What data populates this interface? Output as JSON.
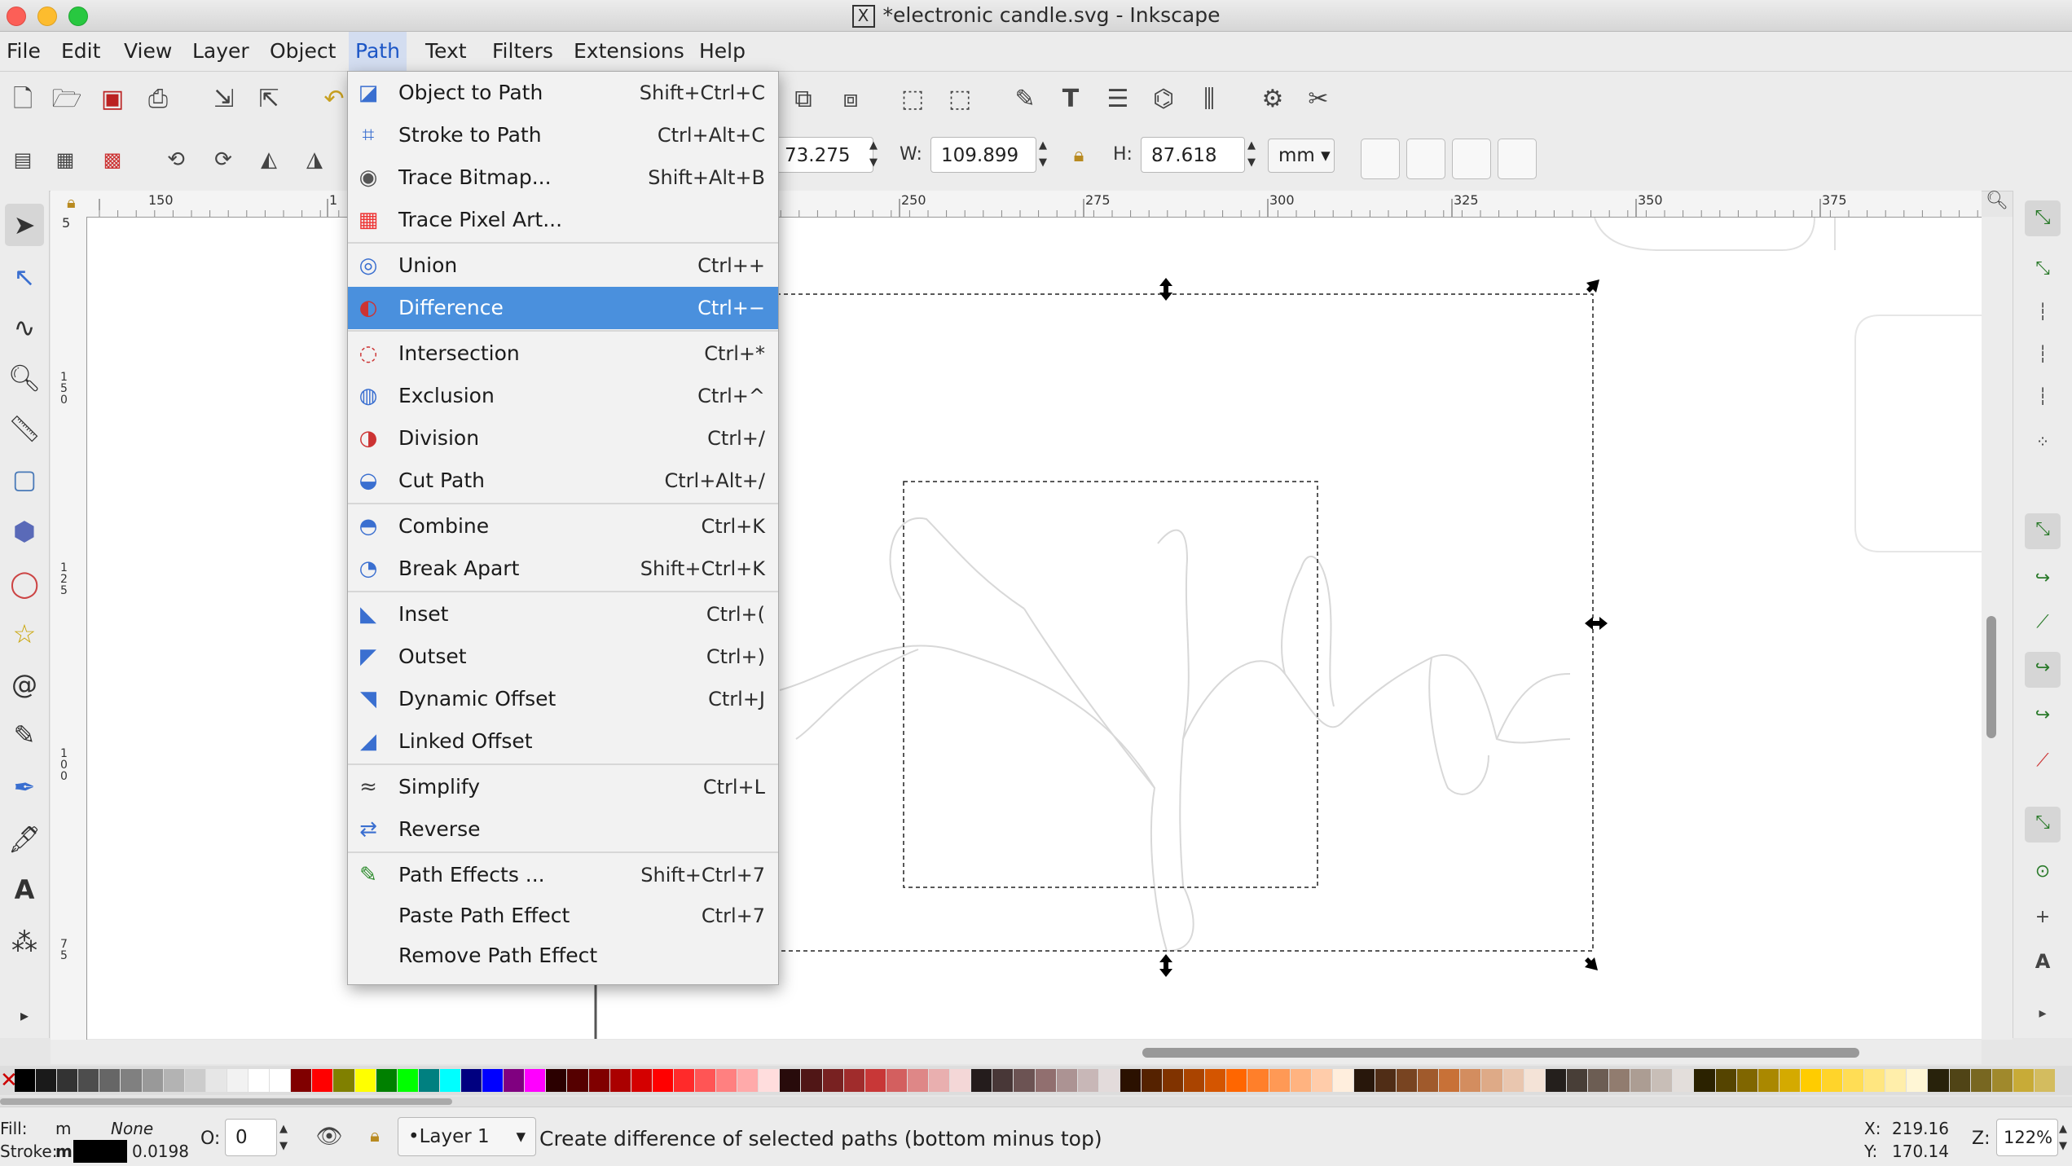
{
  "window": {
    "title": "*electronic candle.svg - Inkscape"
  },
  "menubar": [
    "File",
    "Edit",
    "View",
    "Layer",
    "Object",
    "Path",
    "Text",
    "Filters",
    "Extensions",
    "Help"
  ],
  "open_menu": "Path",
  "path_menu": {
    "items": [
      {
        "label": "Object to Path",
        "shortcut": "Shift+Ctrl+C",
        "icon": "object-to-path-icon"
      },
      {
        "label": "Stroke to Path",
        "shortcut": "Ctrl+Alt+C",
        "icon": "stroke-to-path-icon"
      },
      {
        "label": "Trace Bitmap...",
        "shortcut": "Shift+Alt+B",
        "icon": "trace-bitmap-icon"
      },
      {
        "label": "Trace Pixel Art...",
        "shortcut": "",
        "icon": "trace-pixel-art-icon"
      },
      {
        "label": "Union",
        "shortcut": "Ctrl++",
        "icon": "union-icon"
      },
      {
        "label": "Difference",
        "shortcut": "Ctrl+−",
        "icon": "difference-icon",
        "highlighted": true
      },
      {
        "label": "Intersection",
        "shortcut": "Ctrl+*",
        "icon": "intersection-icon"
      },
      {
        "label": "Exclusion",
        "shortcut": "Ctrl+^",
        "icon": "exclusion-icon"
      },
      {
        "label": "Division",
        "shortcut": "Ctrl+/",
        "icon": "division-icon"
      },
      {
        "label": "Cut Path",
        "shortcut": "Ctrl+Alt+/",
        "icon": "cut-path-icon"
      },
      {
        "label": "Combine",
        "shortcut": "Ctrl+K",
        "icon": "combine-icon"
      },
      {
        "label": "Break Apart",
        "shortcut": "Shift+Ctrl+K",
        "icon": "break-apart-icon"
      },
      {
        "label": "Inset",
        "shortcut": "Ctrl+(",
        "icon": "inset-icon"
      },
      {
        "label": "Outset",
        "shortcut": "Ctrl+)",
        "icon": "outset-icon"
      },
      {
        "label": "Dynamic Offset",
        "shortcut": "Ctrl+J",
        "icon": "dynamic-offset-icon"
      },
      {
        "label": "Linked Offset",
        "shortcut": "",
        "icon": "linked-offset-icon"
      },
      {
        "label": "Simplify",
        "shortcut": "Ctrl+L",
        "icon": "simplify-icon"
      },
      {
        "label": "Reverse",
        "shortcut": "",
        "icon": "reverse-icon"
      },
      {
        "label": "Path Effects ...",
        "shortcut": "Shift+Ctrl+7",
        "icon": "path-effects-icon"
      },
      {
        "label": "Paste Path Effect",
        "shortcut": "Ctrl+7",
        "icon": ""
      },
      {
        "label": "Remove Path Effect",
        "shortcut": "",
        "icon": ""
      }
    ]
  },
  "toolbar": {
    "x_value": "73.275",
    "w_label": "W:",
    "w_value": "109.899",
    "h_label": "H:",
    "h_value": "87.618",
    "unit": "mm"
  },
  "ruler": {
    "h_ticks": [
      "150",
      "1",
      "250",
      "275",
      "300",
      "325",
      "350",
      "375"
    ],
    "v_ticks": [
      "5",
      "1 5 0",
      "1 2 5",
      "1 0 0",
      "7 5"
    ]
  },
  "status": {
    "fill_label": "Fill:",
    "fill_value": "m",
    "fill_none": "None",
    "stroke_label": "Stroke:",
    "stroke_value": "m",
    "stroke_width": "0.0198",
    "opacity_label": "O:",
    "opacity_value": "0",
    "layer": "•Layer 1",
    "message": "Create difference of selected paths (bottom minus top)",
    "x_label": "X:",
    "x_coord": "219.16",
    "y_label": "Y:",
    "y_coord": "170.14",
    "zoom_label": "Z:",
    "zoom_value": "122%"
  },
  "colors": {
    "menu_highlight": "#4a90dd",
    "accent": "#1c56c6"
  }
}
